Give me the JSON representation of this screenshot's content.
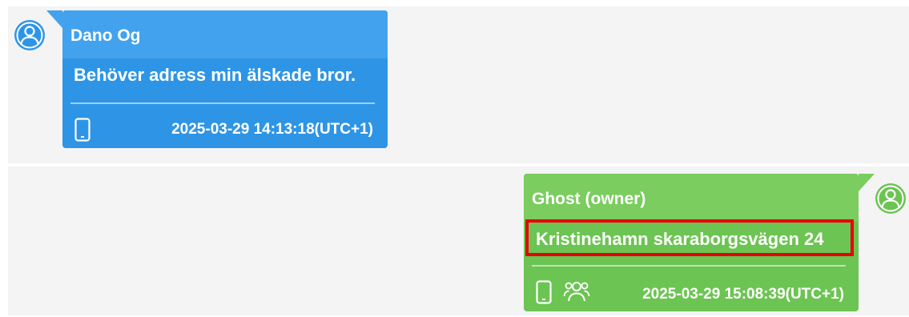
{
  "messages": [
    {
      "sender": "Dano Og",
      "text": "Behöver adress min älskade bror.",
      "timestamp": "2025-03-29 14:13:18(UTC+1)",
      "direction": "incoming",
      "icons": [
        "phone-icon"
      ]
    },
    {
      "sender": "Ghost (owner)",
      "text": "Kristinehamn skaraborgsvägen 24",
      "timestamp": "2025-03-29 15:08:39(UTC+1)",
      "direction": "outgoing",
      "highlighted": true,
      "icons": [
        "phone-icon",
        "group-icon"
      ]
    }
  ],
  "colors": {
    "incoming_bubble": "#2e95e6",
    "outgoing_bubble": "#6cc452",
    "highlight_border": "#e8000b",
    "avatar_incoming": "#2e95e6",
    "avatar_outgoing": "#6cc452"
  }
}
